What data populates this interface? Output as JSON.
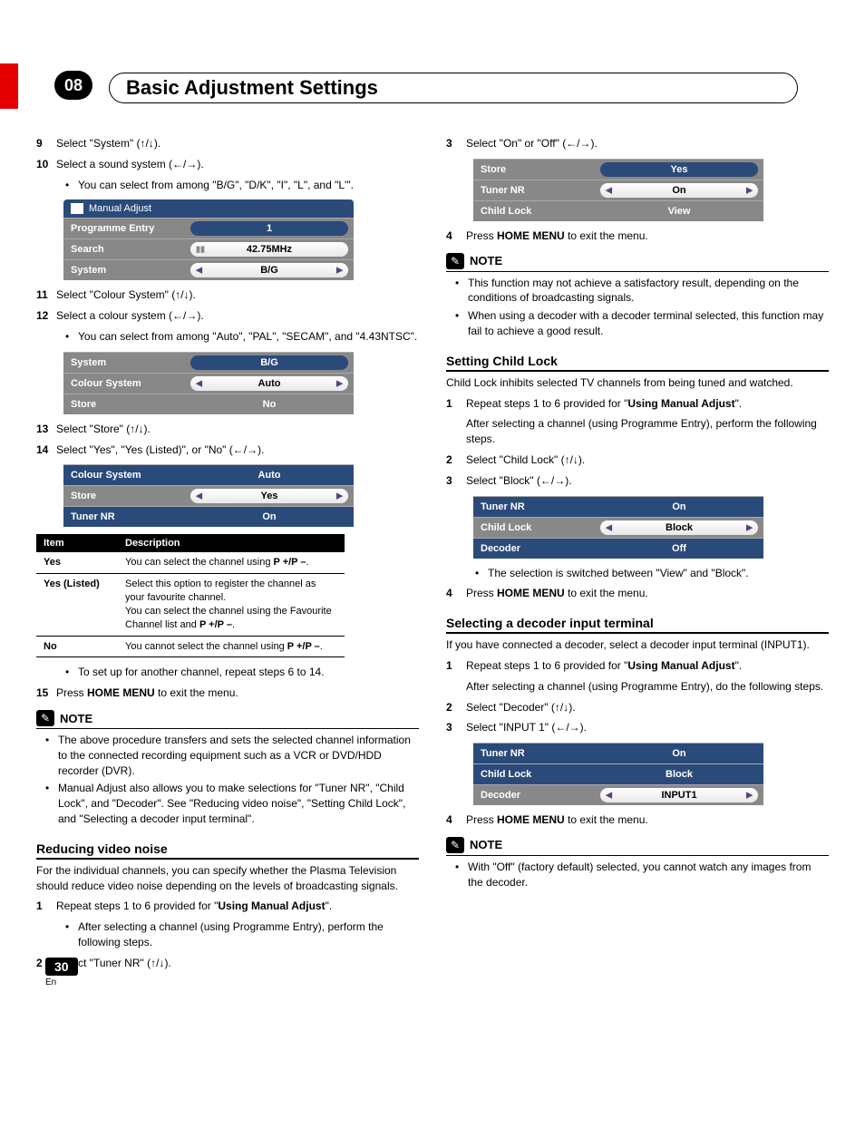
{
  "chapter": {
    "number": "08",
    "title": "Basic Adjustment Settings"
  },
  "left": {
    "s9": "Select \"System\" (↑/↓).",
    "s10": "Select a sound system (←/→).",
    "s10b": "You can select from among \"B/G\", \"D/K\", \"I\", \"L\", and \"L'\".",
    "menu1": {
      "header": "Manual Adjust",
      "r1l": "Programme Entry",
      "r1v": "1",
      "r2l": "Search",
      "r2v": "42.75MHz",
      "r3l": "System",
      "r3v": "B/G"
    },
    "s11": "Select \"Colour System\" (↑/↓).",
    "s12": "Select a colour system (←/→).",
    "s12b": "You can select from among \"Auto\", \"PAL\", \"SECAM\", and \"4.43NTSC\".",
    "menu2": {
      "r1l": "System",
      "r1v": "B/G",
      "r2l": "Colour System",
      "r2v": "Auto",
      "r3l": "Store",
      "r3v": "No"
    },
    "s13": "Select \"Store\" (↑/↓).",
    "s14": "Select \"Yes\", \"Yes (Listed)\", or \"No\" (←/→).",
    "menu3": {
      "r1l": "Colour System",
      "r1v": "Auto",
      "r2l": "Store",
      "r2v": "Yes",
      "r3l": "Tuner NR",
      "r3v": "On"
    },
    "table": {
      "h1": "Item",
      "h2": "Description",
      "r1a": "Yes",
      "r1b": "You can select the channel using P +/P –.",
      "r2a": "Yes (Listed)",
      "r2b": "Select this option to register the channel as your favourite channel.\nYou can select the channel using the Favourite Channel list and P +/P –.",
      "r3a": "No",
      "r3b": "You cannot select the channel using P +/P –."
    },
    "afterTable": "To set up for another channel, repeat steps 6 to 14.",
    "s15a": "Press ",
    "s15b": "HOME MENU",
    "s15c": " to exit the menu.",
    "note": "NOTE",
    "note1": "The above procedure transfers and sets the selected channel information to the connected recording equipment such as a VCR or DVD/HDD recorder (DVR).",
    "note2": "Manual Adjust also allows you to make selections for \"Tuner NR\", \"Child Lock\", and \"Decoder\". See \"Reducing video noise\", \"Setting Child Lock\", and \"Selecting a decoder input terminal\".",
    "secReduce": "Reducing video noise",
    "reducePara": "For the individual channels, you can specify whether the Plasma Television should reduce video noise depending on the levels of broadcasting signals.",
    "r1a": "Repeat steps 1 to 6 provided for \"",
    "r1b": "Using Manual Adjust",
    "r1c": "\".",
    "r1d": "After selecting a channel (using Programme Entry), perform the following steps.",
    "r2": "Select \"Tuner NR\" (↑/↓)."
  },
  "right": {
    "s3": "Select \"On\" or \"Off\" (←/→).",
    "menu1": {
      "r1l": "Store",
      "r1v": "Yes",
      "r2l": "Tuner NR",
      "r2v": "On",
      "r3l": "Child Lock",
      "r3v": "View"
    },
    "s4a": "Press ",
    "s4b": "HOME MENU",
    "s4c": " to exit the menu.",
    "note": "NOTE",
    "note1": "This function may not achieve a satisfactory result, depending on the conditions of broadcasting signals.",
    "note2": "When using a decoder with a decoder terminal selected, this function may fail to achieve a good result.",
    "secChild": "Setting Child Lock",
    "childPara": "Child Lock inhibits selected TV channels from being tuned and watched.",
    "c1a": "Repeat steps 1 to 6 provided for \"",
    "c1b": "Using Manual Adjust",
    "c1c": "\".",
    "c1d": "After selecting a channel (using Programme Entry), perform the following steps.",
    "c2": "Select \"Child Lock\" (↑/↓).",
    "c3": "Select \"Block\" (←/→).",
    "menu2": {
      "r1l": "Tuner NR",
      "r1v": "On",
      "r2l": "Child Lock",
      "r2v": "Block",
      "r3l": "Decoder",
      "r3v": "Off"
    },
    "c3b": "The selection is switched between \"View\" and \"Block\".",
    "c4a": "Press ",
    "c4b": "HOME MENU",
    "c4c": " to exit the menu.",
    "secDecoder": "Selecting a decoder input terminal",
    "decPara": "If you have connected a decoder, select a decoder input terminal (INPUT1).",
    "d1a": "Repeat steps 1 to 6 provided for \"",
    "d1b": "Using Manual Adjust",
    "d1c": "\".",
    "d1d": "After selecting a channel (using Programme Entry), do the following steps.",
    "d2": "Select \"Decoder\" (↑/↓).",
    "d3": "Select \"INPUT 1\" (←/→).",
    "menu3": {
      "r1l": "Tuner NR",
      "r1v": "On",
      "r2l": "Child Lock",
      "r2v": "Block",
      "r3l": "Decoder",
      "r3v": "INPUT1"
    },
    "d4a": "Press ",
    "d4b": "HOME MENU",
    "d4c": " to exit the menu.",
    "dnote": "With \"Off\" (factory default) selected, you cannot watch any images from the decoder."
  },
  "footer": {
    "page": "30",
    "lang": "En"
  }
}
